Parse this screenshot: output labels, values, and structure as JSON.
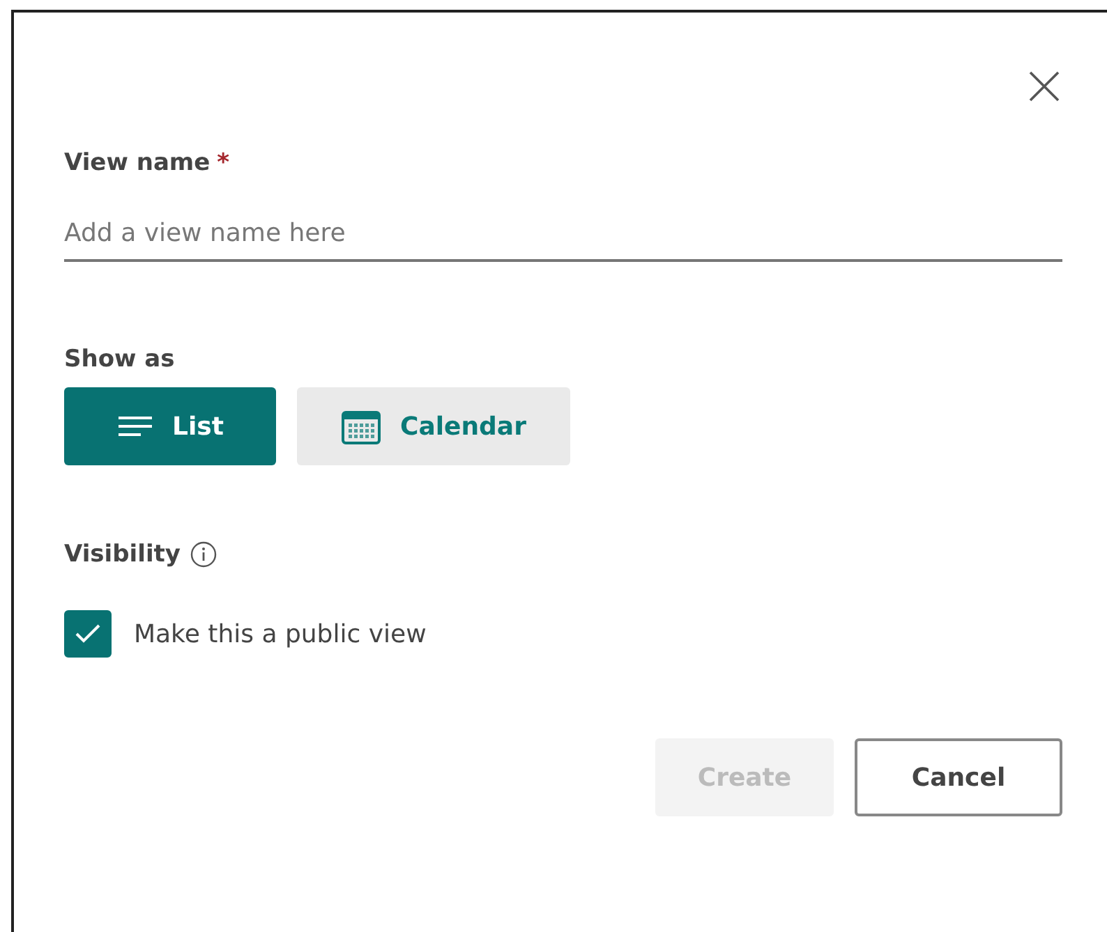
{
  "dialog": {
    "name_field": {
      "label": "View name",
      "required_mark": "*",
      "placeholder": "Add a view name here"
    },
    "show_as": {
      "label": "Show as",
      "options": [
        {
          "label": "List",
          "kind": "list",
          "selected": true
        },
        {
          "label": "Calendar",
          "kind": "calendar",
          "selected": false
        }
      ]
    },
    "visibility": {
      "label": "Visibility",
      "checkbox": {
        "label": "Make this a public view",
        "checked": true
      }
    },
    "buttons": [
      {
        "label": "Create",
        "disabled": true
      },
      {
        "label": "Cancel",
        "disabled": false
      }
    ]
  }
}
